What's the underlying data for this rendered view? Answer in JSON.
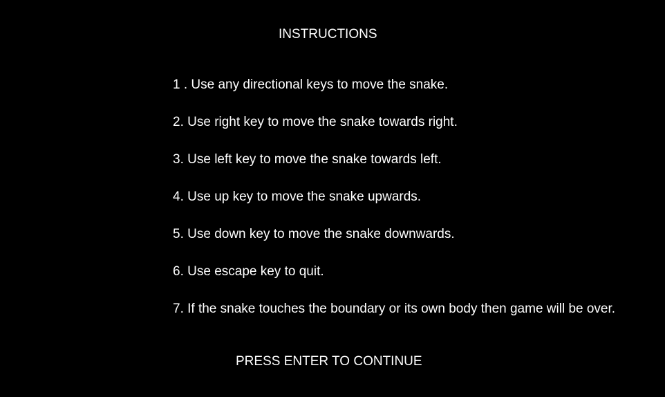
{
  "screen": {
    "background": "#000000",
    "text_color": "#ffffff"
  },
  "title": "INSTRUCTIONS",
  "instructions": [
    "1 . Use any directional keys to move the snake.",
    "2. Use right key to move the snake towards right.",
    "3. Use left key to move the snake towards left.",
    "4. Use up key to move the snake upwards.",
    "5. Use down key to move the snake downwards.",
    "6. Use escape key to quit.",
    "7. If the snake touches the boundary or its own body then game will be over."
  ],
  "prompt": "PRESS ENTER TO CONTINUE"
}
